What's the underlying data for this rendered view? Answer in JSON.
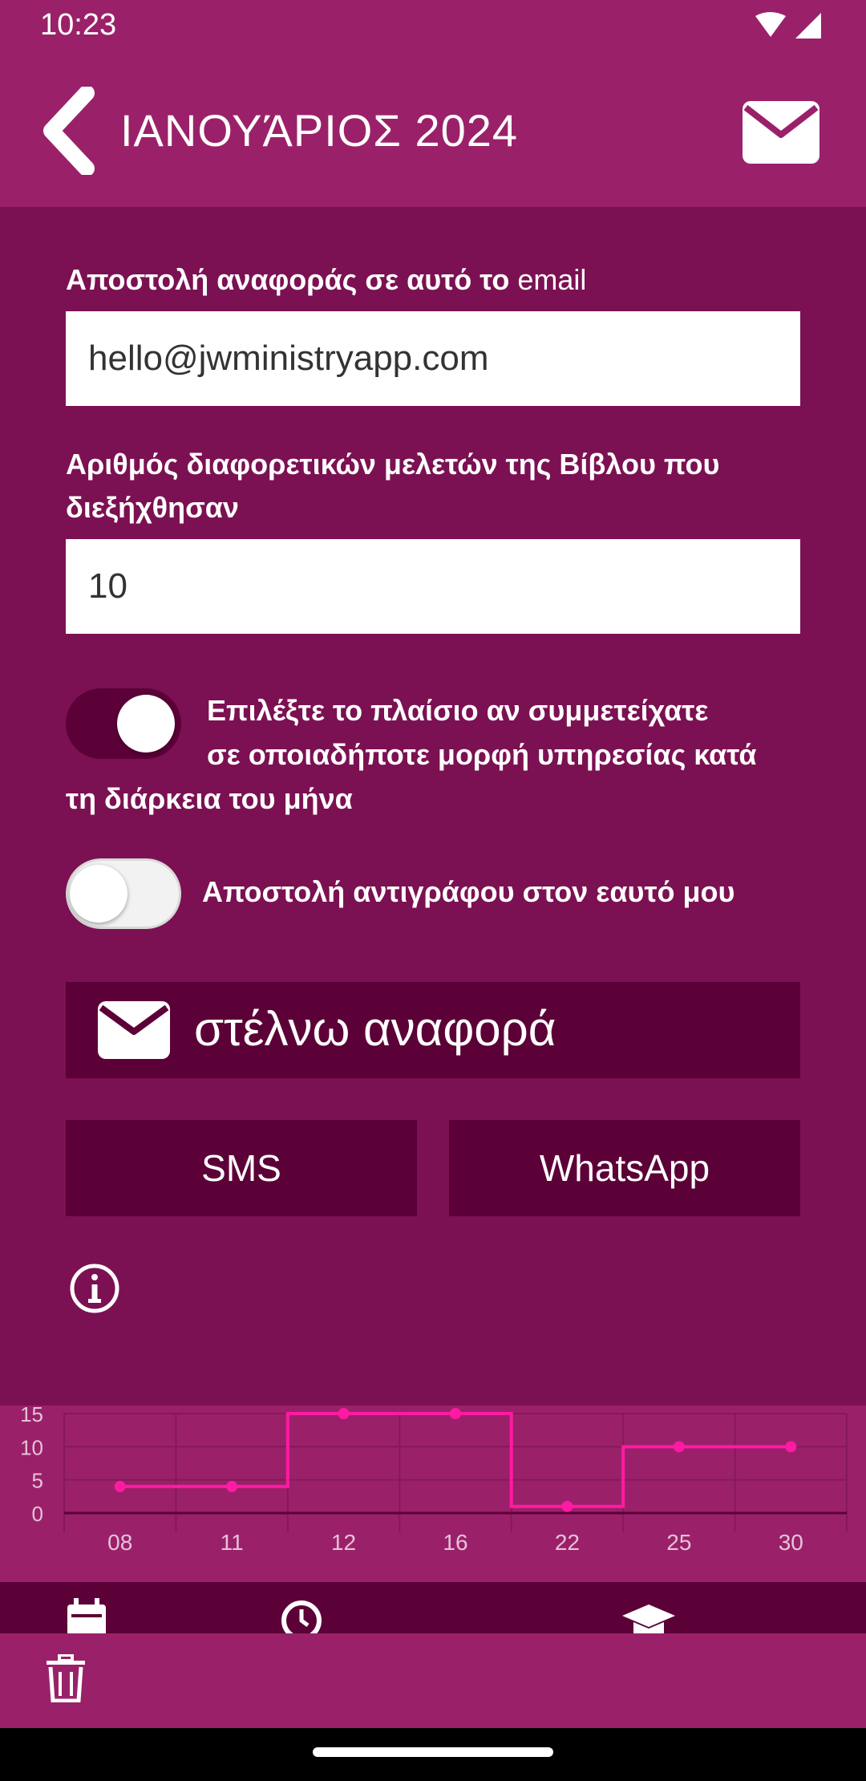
{
  "status_bar": {
    "time": "10:23",
    "icons": [
      "wifi-icon",
      "signal-icon"
    ]
  },
  "header": {
    "month": "ΙΑΝΟΥΆΡΙΟΣ",
    "year": "2024",
    "back_icon": "chevron-left-icon",
    "action_icon": "envelope-icon"
  },
  "form": {
    "email_label_bold": "Αποστολή αναφοράς σε αυτό το",
    "email_label_tail": "email",
    "email_value": "hello@jwministryapp.com",
    "studies_label": "Αριθμός διαφορετικών μελετών της Βίβλου που διεξήχθησαν",
    "studies_value": "10",
    "service_toggle": {
      "on": true,
      "label_line1": "Επιλέξτε το πλαίσιο αν συμμετείχατε",
      "label_line2": "σε οποιαδήποτε μορφή υπηρεσίας κατά",
      "label_line3": "τη διάρκεια του μήνα"
    },
    "copy_toggle": {
      "on": false,
      "label": "Αποστολή αντιγράφου στον εαυτό μου"
    }
  },
  "actions": {
    "send_label": "στέλνω αναφορά",
    "send_icon": "envelope-icon",
    "sms_label": "SMS",
    "whatsapp_label": "WhatsApp",
    "info_icon": "info-icon"
  },
  "chart_data": {
    "type": "line",
    "step": true,
    "categories": [
      "08",
      "11",
      "12",
      "16",
      "22",
      "25",
      "30"
    ],
    "values": [
      4,
      4,
      15,
      15,
      1,
      10,
      10
    ],
    "ylim": [
      0,
      15
    ],
    "yticks": [
      "0",
      "5",
      "10",
      "15"
    ],
    "grid": true,
    "color": "#ff1aa3",
    "title": "",
    "xlabel": "",
    "ylabel": ""
  },
  "tabs": {
    "icons": [
      "calendar-icon",
      "clock-icon",
      "graduation-cap-icon"
    ]
  },
  "bottom": {
    "delete_icon": "trash-icon"
  },
  "colors": {
    "header": "#9a2169",
    "background": "#7b1152",
    "button": "#5c0038",
    "accent": "#ff1aa3"
  }
}
